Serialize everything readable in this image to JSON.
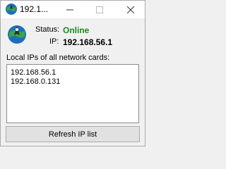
{
  "window": {
    "title": "192.1...",
    "controls": {
      "minimize_icon": "minimize-icon",
      "maximize_icon": "maximize-icon",
      "close_icon": "close-icon"
    },
    "app_icon": "globe-pin-icon"
  },
  "status": {
    "label": "Status:",
    "value": "Online",
    "value_color": "#1b8a1b"
  },
  "ip": {
    "label": "IP:",
    "value": "192.168.56.1"
  },
  "local_ips": {
    "caption": "Local IPs of all network cards:",
    "items": [
      "192.168.56.1",
      "192.168.0.131"
    ]
  },
  "actions": {
    "refresh_label": "Refresh IP list"
  }
}
